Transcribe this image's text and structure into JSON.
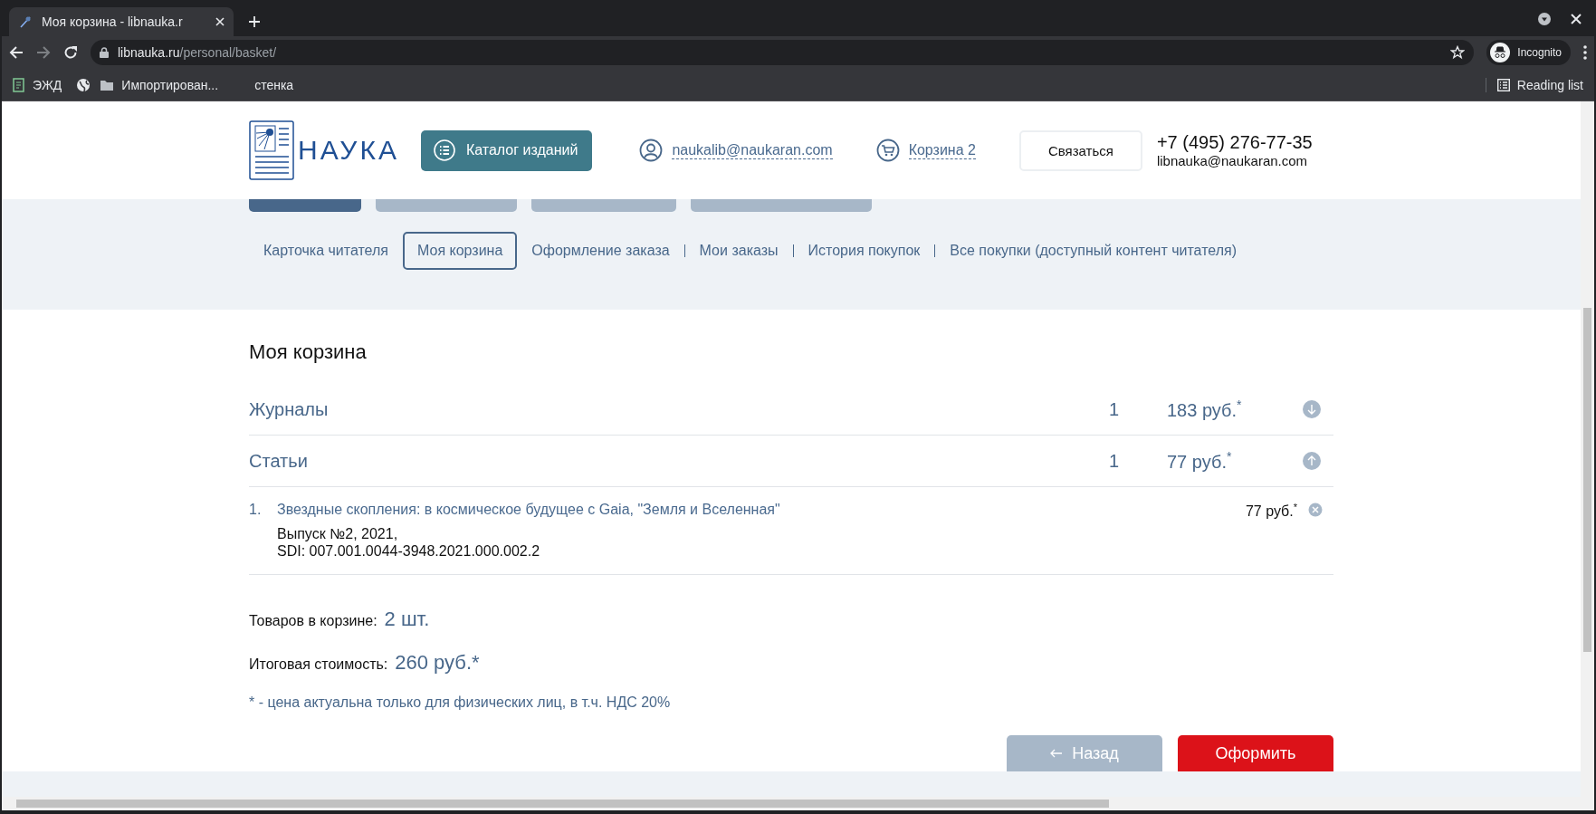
{
  "browser": {
    "tab_title": "Моя корзина - libnauka.r",
    "url_host": "libnauka.ru",
    "url_path": "/personal/basket/",
    "profile": "Incognito",
    "bookmarks": [
      {
        "kind": "site",
        "label": "ЭЖД"
      },
      {
        "kind": "globe"
      },
      {
        "kind": "folder",
        "label": "Импортирован..."
      },
      {
        "kind": "blank",
        "label": "стенка"
      }
    ],
    "reading_list": "Reading list"
  },
  "header": {
    "logo_text": "НАУКА",
    "catalog_button": "Каталог изданий",
    "account_email": "naukalib@naukaran.com",
    "cart_link": "Корзина 2",
    "contact_button": "Связаться",
    "phone": "+7 (495) 276-77-35",
    "contact_email": "libnauka@naukaran.com"
  },
  "top_buttons": [
    {
      "selected": true
    },
    {
      "selected": false
    },
    {
      "selected": false
    },
    {
      "selected": false
    }
  ],
  "subnav": [
    {
      "label": "Карточка читателя",
      "selected": false
    },
    {
      "label": "Моя корзина",
      "selected": true
    },
    {
      "label": "Оформление заказа",
      "selected": false
    },
    {
      "label": "Мои заказы",
      "selected": false
    },
    {
      "label": "История покупок",
      "selected": false
    },
    {
      "label": "Все покупки (доступный контент читателя)",
      "selected": false
    }
  ],
  "basket": {
    "title": "Моя корзина",
    "groups": [
      {
        "name": "Журналы",
        "count": "1",
        "price": "183 руб.$^{*}$",
        "expanded": false
      },
      {
        "name": "Статьи",
        "count": "1",
        "price": "77 руб.$^{*}$",
        "expanded": true,
        "items": [
          {
            "number": "1.",
            "title": "Звездные скопления: в космическое будущее с Gaia, \"Земля и Вселенная\"",
            "details": [
              "Выпуск №2, 2021,",
              "SDI: 007.001.0044-3948.2021.000.002.2"
            ],
            "price": "77 руб.$^{*}$"
          }
        ]
      }
    ],
    "totals": [
      {
        "label": "Товаров в корзине:",
        "value": "2 шт."
      },
      {
        "label": "Итоговая стоимость:",
        "value": "260 руб.*"
      }
    ],
    "note": "* - цена актуальна только для физических лиц, в т.ч. НДС 20%",
    "buttons": [
      {
        "kind": "back",
        "label": "Назад"
      },
      {
        "kind": "primary",
        "label": "Оформить"
      }
    ]
  }
}
